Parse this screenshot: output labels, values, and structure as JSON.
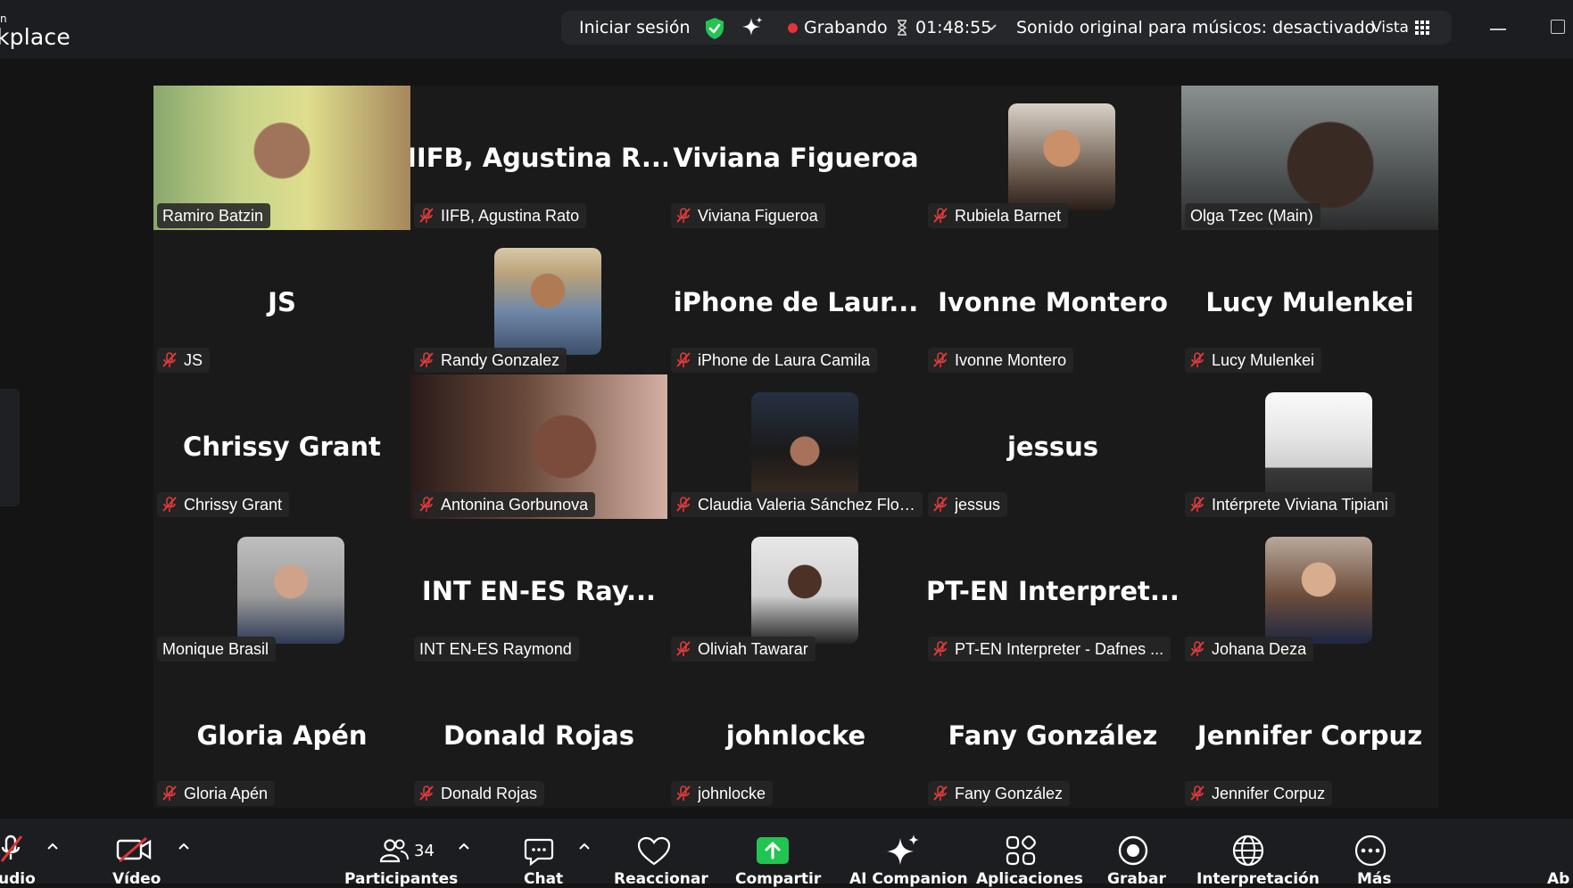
{
  "app": {
    "title": "kplace",
    "title_top": "n"
  },
  "topbar": {
    "signin": "Iniciar sesión",
    "recording": "Grabando",
    "timer": "01:48:55",
    "music": "Sonido original para músicos: desactivado",
    "view": "Vista",
    "colors": {
      "shield": "#23c552",
      "record": "#e23636",
      "active_border": "#23d18b"
    }
  },
  "tiles": [
    {
      "label": "Ramiro Batzin",
      "type": "video",
      "muted": false
    },
    {
      "big": "IIFB, Agustina R...",
      "label": "IIFB, Agustina Rato",
      "type": "name",
      "muted": true
    },
    {
      "big": "Viviana Figueroa",
      "label": "Viviana Figueroa",
      "type": "name",
      "muted": true
    },
    {
      "label": "Rubiela Barnet",
      "type": "avatar",
      "muted": true
    },
    {
      "label": "Olga Tzec (Main)",
      "type": "video",
      "muted": false,
      "active": true
    },
    {
      "big": "JS",
      "label": "JS",
      "type": "name",
      "muted": true
    },
    {
      "label": "Randy Gonzalez",
      "type": "avatar",
      "muted": true
    },
    {
      "big": "iPhone de Laur...",
      "label": "iPhone de Laura Camila",
      "type": "name",
      "muted": true
    },
    {
      "big": "Ivonne Montero",
      "label": "Ivonne Montero",
      "type": "name",
      "muted": true
    },
    {
      "big": "Lucy Mulenkei",
      "label": "Lucy Mulenkei",
      "type": "name",
      "muted": true
    },
    {
      "big": "Chrissy Grant",
      "label": "Chrissy Grant",
      "type": "name",
      "muted": true
    },
    {
      "label": "Antonina Gorbunova",
      "type": "video",
      "muted": true
    },
    {
      "label": "Claudia Valeria Sánchez Flor...",
      "type": "avatar",
      "muted": true
    },
    {
      "big": "jessus",
      "label": "jessus",
      "type": "name",
      "muted": true
    },
    {
      "label": "Intérprete Viviana Tipiani",
      "type": "avatar",
      "muted": true
    },
    {
      "label": "Monique Brasil",
      "type": "avatar",
      "muted": false
    },
    {
      "big": "INT EN-ES Ray...",
      "label": "INT EN-ES Raymond",
      "type": "name",
      "muted": false
    },
    {
      "label": "Oliviah Tawarar",
      "type": "avatar",
      "muted": true
    },
    {
      "big": "PT-EN Interpret...",
      "label": "PT-EN Interpreter - Dafnes ...",
      "type": "name",
      "muted": true
    },
    {
      "label": "Johana Deza",
      "type": "avatar",
      "muted": true
    },
    {
      "big": "Gloria Apén",
      "label": "Gloria Apén",
      "type": "name",
      "muted": true
    },
    {
      "big": "Donald Rojas",
      "label": "Donald Rojas",
      "type": "name",
      "muted": true
    },
    {
      "big": "johnlocke",
      "label": "johnlocke",
      "type": "name",
      "muted": true
    },
    {
      "big": "Fany González",
      "label": "Fany González",
      "type": "name",
      "muted": true
    },
    {
      "big": "Jennifer Corpuz",
      "label": "Jennifer Corpuz",
      "type": "name",
      "muted": true
    }
  ],
  "toolbar": {
    "audio": "udio",
    "video": "Vídeo",
    "participants": "Participantes",
    "participants_count": "34",
    "chat": "Chat",
    "react": "Reaccionar",
    "share": "Compartir",
    "ai": "AI Companion",
    "apps": "Aplicaciones",
    "record": "Grabar",
    "interpretation": "Interpretación",
    "more": "Más",
    "edge": "Ab",
    "share_color": "#23c552"
  }
}
